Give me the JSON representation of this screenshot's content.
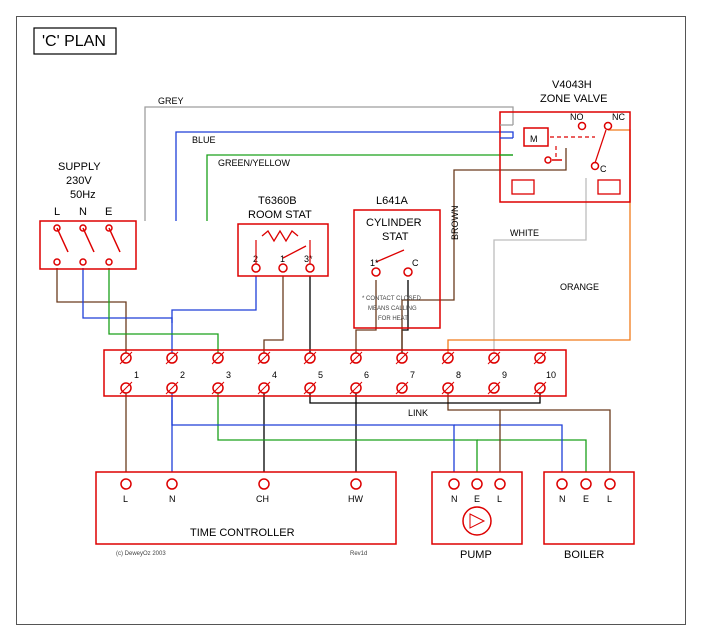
{
  "title": "'C' PLAN",
  "supply": {
    "label": "SUPPLY",
    "voltage": "230V",
    "freq": "50Hz",
    "terms": [
      "L",
      "N",
      "E"
    ]
  },
  "valve": {
    "model": "V4043H",
    "label": "ZONE VALVE",
    "m": "M",
    "no": "NO",
    "nc": "NC",
    "c": "C"
  },
  "roomstat": {
    "model": "T6360B",
    "label": "ROOM STAT",
    "terms": [
      "2",
      "1",
      "3*"
    ]
  },
  "cylstat": {
    "model": "L641A",
    "label1": "CYLINDER",
    "label2": "STAT",
    "terms": [
      "1*",
      "C"
    ],
    "note1": "* CONTACT CLOSED",
    "note2": "MEANS CALLING",
    "note3": "FOR HEAT"
  },
  "junction": {
    "terms": [
      "1",
      "2",
      "3",
      "4",
      "5",
      "6",
      "7",
      "8",
      "9",
      "10"
    ],
    "link": "LINK"
  },
  "timectl": {
    "label": "TIME CONTROLLER",
    "terms": [
      "L",
      "N",
      "CH",
      "HW"
    ]
  },
  "pump": {
    "label": "PUMP",
    "terms": [
      "N",
      "E",
      "L"
    ]
  },
  "boiler": {
    "label": "BOILER",
    "terms": [
      "N",
      "E",
      "L"
    ]
  },
  "wire_labels": {
    "grey": "GREY",
    "blue": "BLUE",
    "green": "GREEN/YELLOW",
    "brown": "BROWN",
    "white": "WHITE",
    "orange": "ORANGE"
  },
  "footer": {
    "copy": "(c) DeweyOz 2003",
    "rev": "Rev1d"
  }
}
